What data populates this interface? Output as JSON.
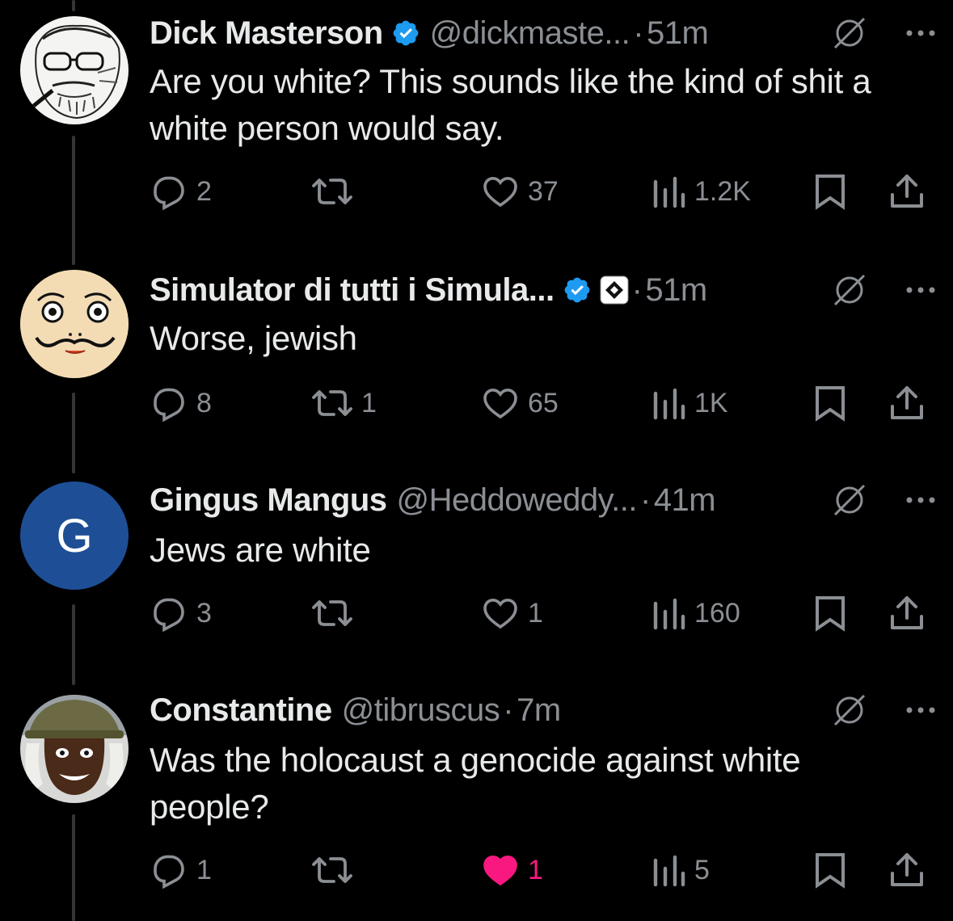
{
  "colors": {
    "background": "#000000",
    "text": "#e7e9ea",
    "secondary": "#8b8f94",
    "verified": "#1d9bf0",
    "like_active": "#f91880",
    "avatar_g": "#1e4f96"
  },
  "tweets": [
    {
      "name": "Dick Masterson",
      "verified": true,
      "handle": "@dickmaste...",
      "dot": "·",
      "time": "51m",
      "text": "Are you white? This sounds like the kind of shit a white person would say.",
      "avatar": "sketch-face-avatar",
      "replies": "2",
      "retweets": "",
      "likes": "37",
      "liked": false,
      "views": "1.2K"
    },
    {
      "name": "Simulator di tutti i Simula...",
      "verified": true,
      "affiliate_badge": true,
      "handle": "",
      "dot": "·",
      "time": "51m",
      "text": "Worse, jewish",
      "avatar": "mustache-face-avatar",
      "replies": "8",
      "retweets": "1",
      "likes": "65",
      "liked": false,
      "views": "1K"
    },
    {
      "name": "Gingus Mangus",
      "verified": false,
      "handle": "@Heddoweddy...",
      "dot": "·",
      "time": "41m",
      "text": "Jews are white",
      "avatar": "letter-avatar",
      "avatar_letter": "G",
      "replies": "3",
      "retweets": "",
      "likes": "1",
      "liked": false,
      "views": "160"
    },
    {
      "name": "Constantine",
      "verified": false,
      "handle": "@tibruscus",
      "dot": "·",
      "time": "7m",
      "text": "Was the holocaust a genocide against white people?",
      "avatar": "helmet-man-avatar",
      "replies": "1",
      "retweets": "",
      "likes": "1",
      "liked": true,
      "views": "5"
    }
  ]
}
